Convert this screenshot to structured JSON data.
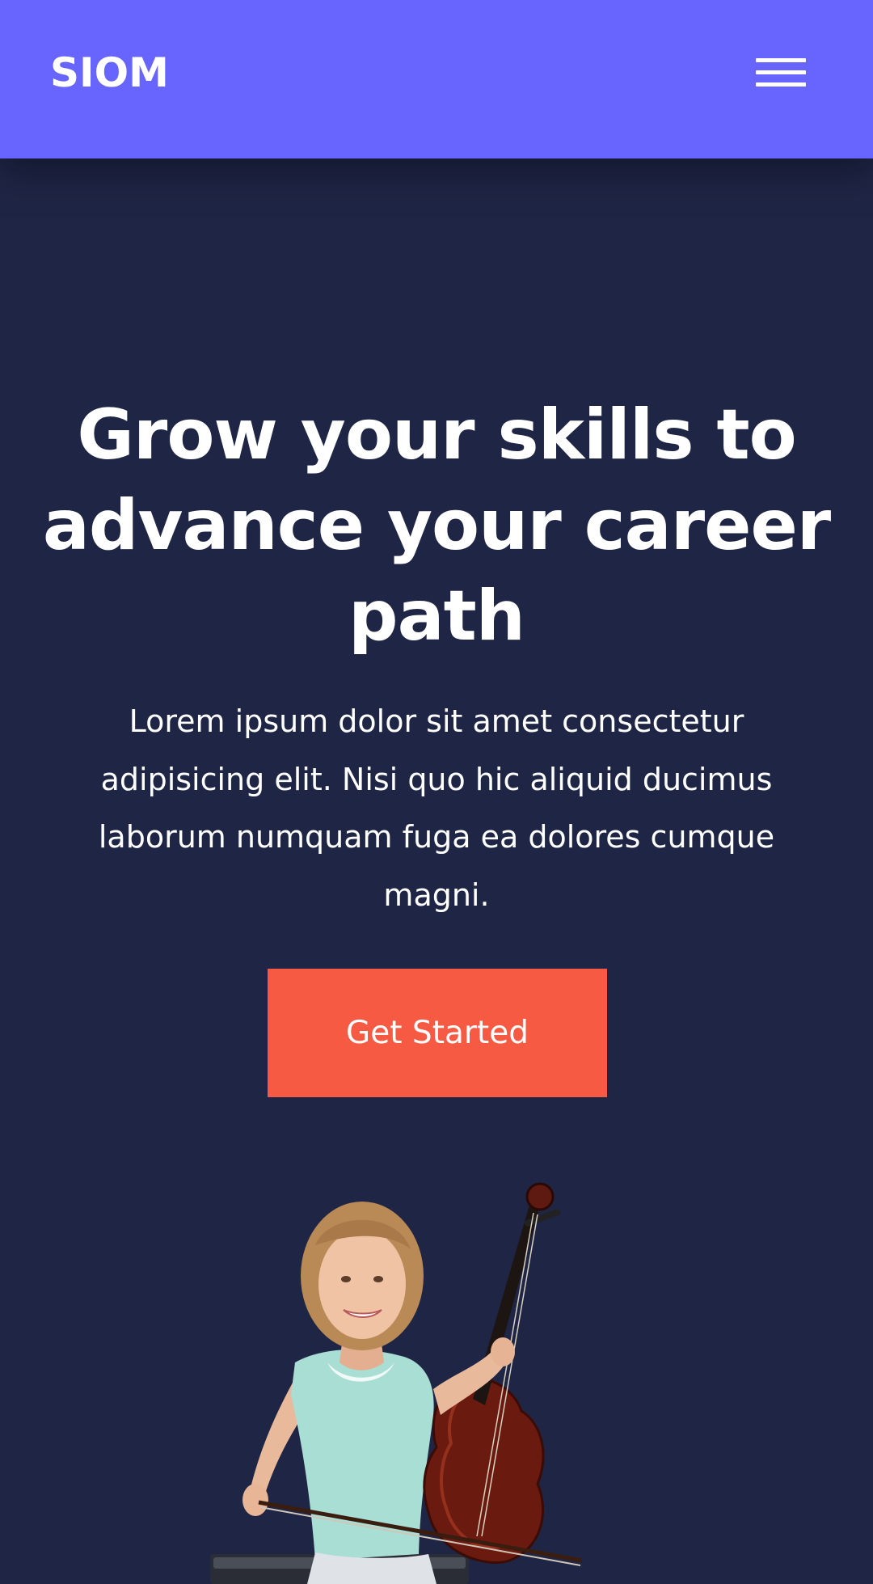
{
  "header": {
    "logo": "SIOM",
    "menu_icon": "hamburger-menu-icon",
    "background_color": "#6865ff"
  },
  "hero": {
    "title": "Grow your skills to advance your career path",
    "description": "Lorem ipsum dolor sit amet consectetur adipisicing elit. Nisi quo hic aliquid ducimus laborum numquam fuga ea dolores cumque magni.",
    "cta_label": "Get Started",
    "cta_color": "#f75a43",
    "background_color": "#1f2544"
  }
}
